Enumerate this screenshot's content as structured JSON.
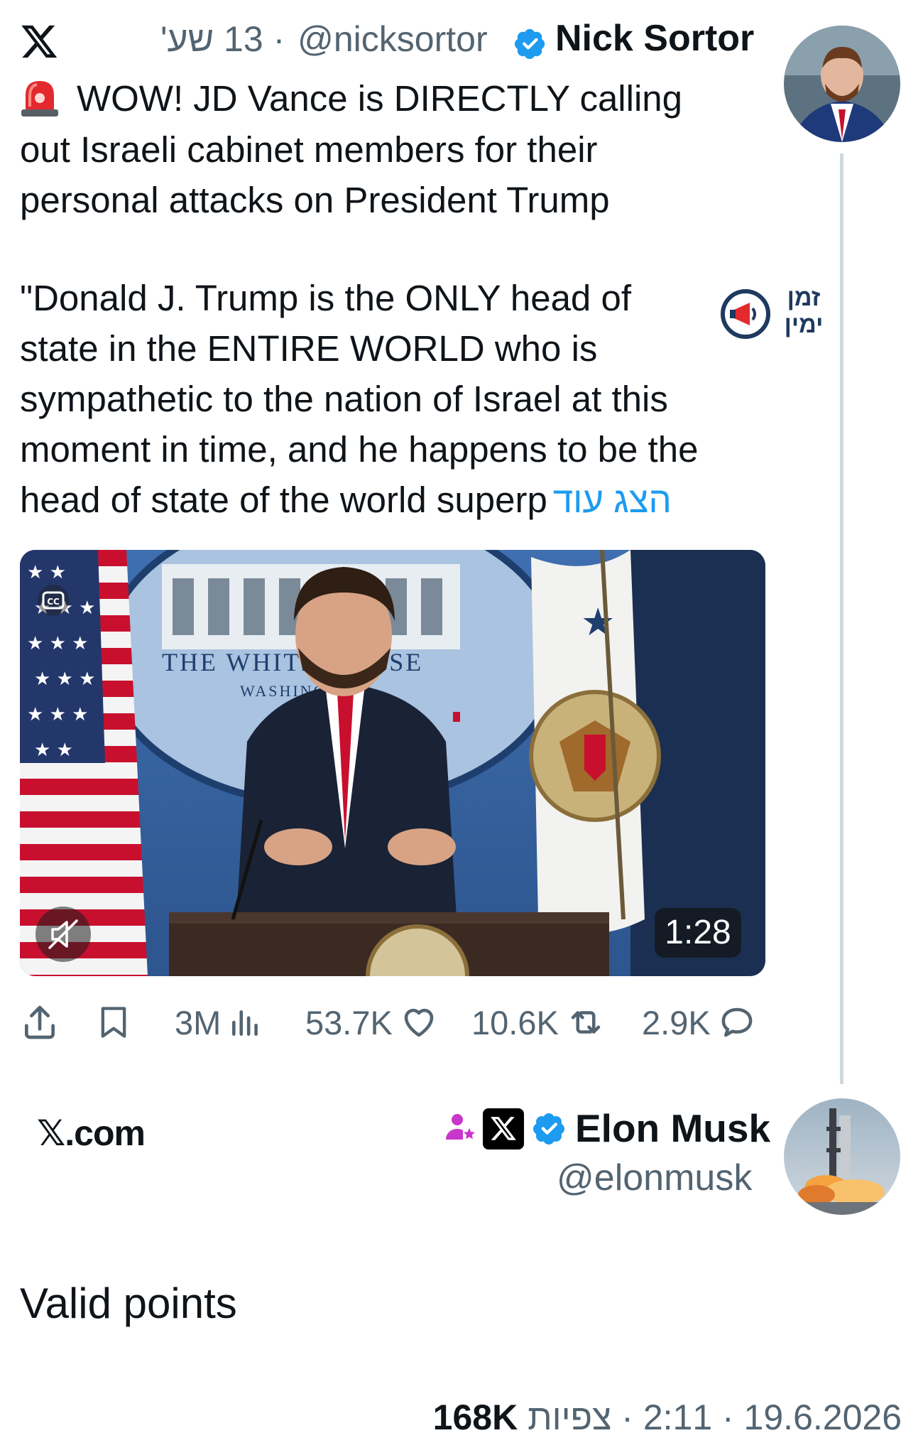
{
  "quoted_tweet": {
    "author_name": "Nick Sortor",
    "handle": "@nicksortor",
    "time_ago": "13 שע'",
    "line1": "WOW! JD Vance is DIRECTLY calling",
    "body": "out Israeli cabinet members for their\npersonal attacks on President Trump",
    "quote": "\"Donald J. Trump is the ONLY head of\nstate in the ENTIRE WORLD who is\nsympathetic to the nation of Israel at this\nmoment in time, and he happens to be the\nhead of state of the world superp",
    "show_more": "הצג עוד",
    "channel_logo_text": "זמן ימין",
    "video": {
      "duration": "1:28",
      "backdrop_text": "THE WHITE HOUSE",
      "backdrop_subtext": "WASHINGTON"
    },
    "stats": {
      "views": "3M",
      "likes": "53.7K",
      "reposts": "10.6K",
      "replies": "2.9K"
    }
  },
  "reply_tweet": {
    "source_label": "𝕏.com",
    "author_name": "Elon Musk",
    "handle": "@elonmusk",
    "text": "Valid points",
    "timestamp": "2:11 · 19.6.2026",
    "views_count": "168K",
    "views_label": "צפיות"
  },
  "colors": {
    "accent": "#1d9bf0",
    "secondary_text": "#536471",
    "thread_line": "#cfd9de",
    "affiliate_badge": "#c936cc"
  },
  "icons": [
    "x-logo-icon",
    "verified-icon",
    "siren-icon",
    "cc-icon",
    "mute-icon",
    "share-icon",
    "bookmark-icon",
    "views-icon",
    "like-icon",
    "repost-icon",
    "reply-icon",
    "affiliate-icon"
  ]
}
